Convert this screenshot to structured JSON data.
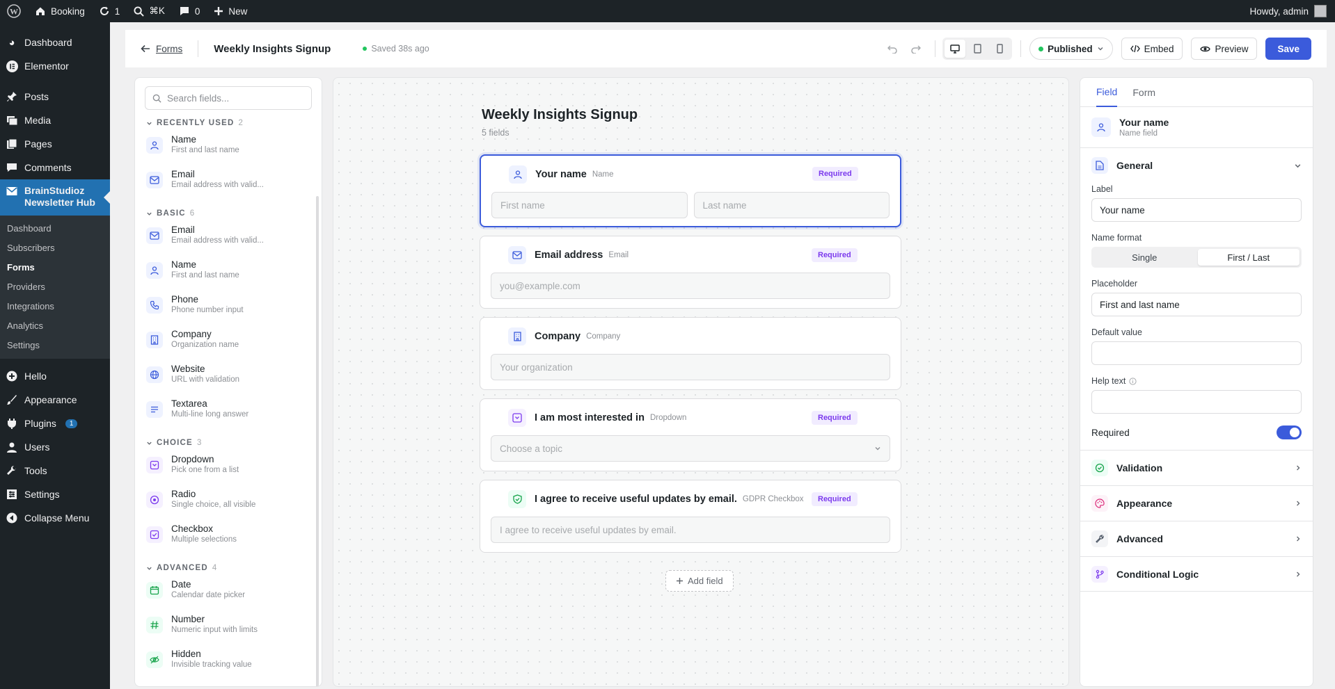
{
  "admin_bar": {
    "site": "Booking",
    "updates": "1",
    "search_shortcut": "⌘K",
    "comments": "0",
    "new": "New",
    "howdy": "Howdy, admin"
  },
  "wp_menu": {
    "items_top": [
      {
        "label": "Dashboard",
        "icon": "dashboard-icon"
      },
      {
        "label": "Elementor",
        "icon": "elementor-icon"
      }
    ],
    "items_mid": [
      {
        "label": "Posts",
        "icon": "pin-icon"
      },
      {
        "label": "Media",
        "icon": "media-icon"
      },
      {
        "label": "Pages",
        "icon": "pages-icon"
      },
      {
        "label": "Comments",
        "icon": "comments-icon"
      }
    ],
    "active": {
      "line1": "BrainStudioz",
      "line2": "Newsletter Hub"
    },
    "submenu": [
      "Dashboard",
      "Subscribers",
      "Forms",
      "Providers",
      "Integrations",
      "Analytics",
      "Settings"
    ],
    "items_bottom": [
      {
        "label": "Hello",
        "icon": "hello-icon"
      },
      {
        "label": "Appearance",
        "icon": "brush-icon"
      },
      {
        "label": "Plugins",
        "icon": "plug-icon",
        "badge": "1"
      },
      {
        "label": "Users",
        "icon": "users-icon"
      },
      {
        "label": "Tools",
        "icon": "wrench-icon"
      },
      {
        "label": "Settings",
        "icon": "settings-icon"
      },
      {
        "label": "Collapse Menu",
        "icon": "collapse-icon"
      }
    ]
  },
  "toolbar": {
    "back": "Forms",
    "title": "Weekly Insights Signup",
    "saved": "Saved 38s ago",
    "status": "Published",
    "embed": "Embed",
    "preview": "Preview",
    "save": "Save"
  },
  "fields_panel": {
    "search_placeholder": "Search fields...",
    "sections": [
      {
        "title": "RECENTLY USED",
        "count": "2",
        "items": [
          {
            "name": "Name",
            "desc": "First and last name",
            "icon": "person-icon"
          },
          {
            "name": "Email",
            "desc": "Email address with valid...",
            "icon": "mail-icon"
          }
        ]
      },
      {
        "title": "BASIC",
        "count": "6",
        "items": [
          {
            "name": "Email",
            "desc": "Email address with valid...",
            "icon": "mail-icon"
          },
          {
            "name": "Name",
            "desc": "First and last name",
            "icon": "person-icon"
          },
          {
            "name": "Phone",
            "desc": "Phone number input",
            "icon": "phone-icon"
          },
          {
            "name": "Company",
            "desc": "Organization name",
            "icon": "building-icon"
          },
          {
            "name": "Website",
            "desc": "URL with validation",
            "icon": "globe-icon"
          },
          {
            "name": "Textarea",
            "desc": "Multi-line long answer",
            "icon": "lines-icon"
          }
        ]
      },
      {
        "title": "CHOICE",
        "count": "3",
        "items": [
          {
            "name": "Dropdown",
            "desc": "Pick one from a list",
            "icon": "dropdown-icon"
          },
          {
            "name": "Radio",
            "desc": "Single choice, all visible",
            "icon": "radio-icon"
          },
          {
            "name": "Checkbox",
            "desc": "Multiple selections",
            "icon": "checkbox-icon"
          }
        ]
      },
      {
        "title": "ADVANCED",
        "count": "4",
        "items": [
          {
            "name": "Date",
            "desc": "Calendar date picker",
            "icon": "calendar-icon"
          },
          {
            "name": "Number",
            "desc": "Numeric input with limits",
            "icon": "hash-icon"
          },
          {
            "name": "Hidden",
            "desc": "Invisible tracking value",
            "icon": "eye-off-icon"
          }
        ]
      }
    ]
  },
  "form": {
    "title": "Weekly Insights Signup",
    "count": "5 fields",
    "required_label": "Required",
    "fields": [
      {
        "label": "Your name",
        "type": "Name",
        "required": true,
        "placeholders": [
          "First name",
          "Last name"
        ]
      },
      {
        "label": "Email address",
        "type": "Email",
        "required": true,
        "placeholder": "you@example.com"
      },
      {
        "label": "Company",
        "type": "Company",
        "required": false,
        "placeholder": "Your organization"
      },
      {
        "label": "I am most interested in",
        "type": "Dropdown",
        "required": true,
        "placeholder": "Choose a topic"
      },
      {
        "label": "I agree to receive useful updates by email.",
        "type": "GDPR Checkbox",
        "required": true,
        "placeholder": "I agree to receive useful updates by email."
      }
    ],
    "add_field": "Add field"
  },
  "settings_panel": {
    "tabs": [
      "Field",
      "Form"
    ],
    "selected": {
      "name": "Your name",
      "sub": "Name field"
    },
    "general": "General",
    "label_label": "Label",
    "label_value": "Your name",
    "format_label": "Name format",
    "format_options": [
      "Single",
      "First / Last"
    ],
    "format_selected": "First / Last",
    "placeholder_label": "Placeholder",
    "placeholder_value": "First and last name",
    "default_label": "Default value",
    "help_label": "Help text",
    "required_label": "Required",
    "required_on": true,
    "sections": [
      "Validation",
      "Appearance",
      "Advanced",
      "Conditional Logic"
    ]
  },
  "colors": {
    "accent": "#3b5bdb",
    "wp_blue": "#2271b1",
    "success": "#22c55e",
    "required_purple": "#7c3aed"
  }
}
